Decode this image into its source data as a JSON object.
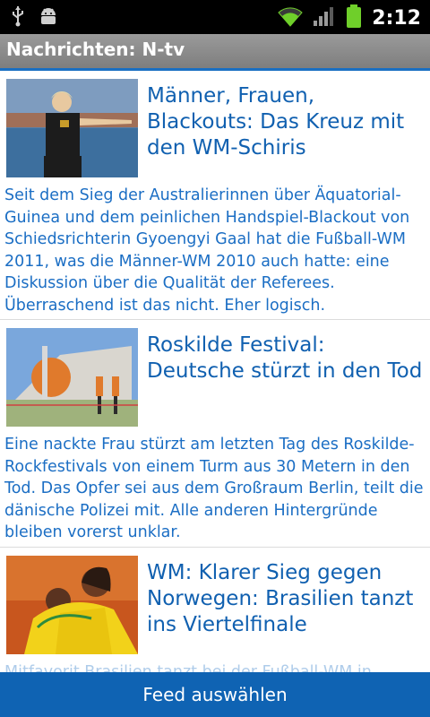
{
  "statusbar": {
    "time": "2:12"
  },
  "titlebar": {
    "title": "Nachrichten: N-tv"
  },
  "articles": [
    {
      "headline": "Männer, Frauen, Blackouts: Das Kreuz mit den WM-Schiris",
      "description": "Seit dem Sieg der Australierinnen über Äquatorial-Guinea und dem peinlichen Handspiel-Blackout von Schiedsrichterin Gyoengyi Gaal hat die Fußball-WM 2011, was die Männer-WM 2010 auch hatte: eine Diskussion über die Qualität der Referees. Überraschend ist das nicht. Eher logisch."
    },
    {
      "headline": "Roskilde Festival: Deutsche stürzt in den Tod",
      "description": "Eine nackte Frau stürzt am letzten Tag des Roskilde-Rockfestivals von einem Turm aus 30 Metern in den Tod. Das Opfer sei aus dem Großraum Berlin, teilt die dänische Polizei mit. Alle anderen Hintergründe bleiben vorerst unklar."
    },
    {
      "headline": "WM: Klarer Sieg gegen Norwegen: Brasilien tanzt ins Viertelfinale",
      "description": "Mitfavorit Brasilien tanzt bei der Fußball-WM in"
    }
  ],
  "bottombar": {
    "button_label": "Feed auswählen"
  },
  "colors": {
    "accent": "#1a6fc2",
    "link": "#1060b0",
    "button_bg": "#0f63b3"
  }
}
